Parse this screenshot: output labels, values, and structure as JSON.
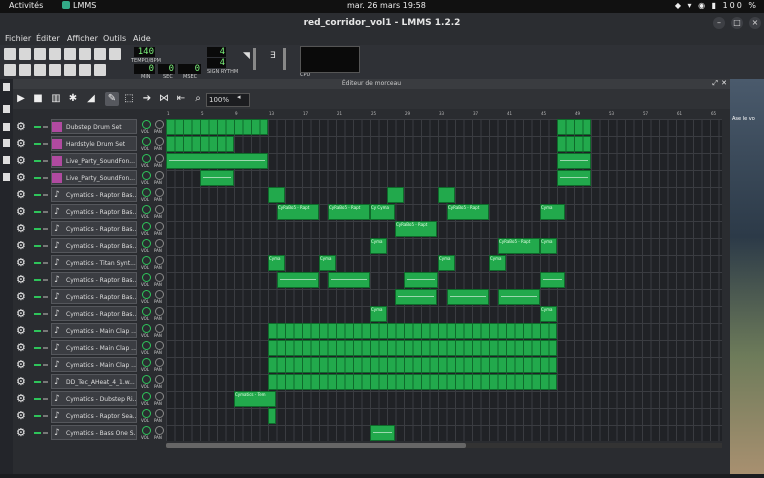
{
  "gnome": {
    "activities": "Activités",
    "app": "LMMS",
    "clock": "mar. 26 mars  19:58",
    "battery": "100 %"
  },
  "window": {
    "title": "red_corridor_vol1 - LMMS 1.2.2"
  },
  "menu": {
    "file": "Fichier",
    "edit": "Éditer",
    "view": "Afficher",
    "tools": "Outils",
    "help": "Aide"
  },
  "toolbar": {
    "tempo": "140",
    "tempo_label": "TEMPO/BPM",
    "time_min": "0",
    "time_sec": "0",
    "time_msec": "0",
    "min_label": "MIN",
    "sec_label": "SEC",
    "msec_label": "MSEC",
    "sig_num": "4",
    "sig_den": "4",
    "sig_label": "SIGN RYTHM",
    "cpu_label": "CPU"
  },
  "song_editor": {
    "title": "Éditeur de morceau",
    "zoom": "100%",
    "bars": [
      "1",
      "5",
      "9",
      "13",
      "17",
      "21",
      "25",
      "29",
      "33",
      "37",
      "41",
      "45",
      "49",
      "53",
      "57",
      "61",
      "65"
    ]
  },
  "knob_labels": {
    "vol": "VOL",
    "pan": "PAN"
  },
  "tracks": [
    {
      "name": "Dubstep Drum Set",
      "type": "drum"
    },
    {
      "name": "Hardstyle Drum Set",
      "type": "drum"
    },
    {
      "name": "Live_Party_SoundFon...",
      "type": "drum"
    },
    {
      "name": "Live_Party_SoundFon...",
      "type": "drum"
    },
    {
      "name": "Cymatics - Raptor Bas...",
      "type": "note"
    },
    {
      "name": "Cymatics - Raptor Bas...",
      "type": "note"
    },
    {
      "name": "Cymatics - Raptor Bas...",
      "type": "note"
    },
    {
      "name": "Cymatics - Raptor Bas...",
      "type": "note"
    },
    {
      "name": "Cymatics - Titan Synt...",
      "type": "note"
    },
    {
      "name": "Cymatics - Raptor Bas...",
      "type": "note"
    },
    {
      "name": "Cymatics - Raptor Bas...",
      "type": "note"
    },
    {
      "name": "Cymatics - Raptor Bas...",
      "type": "note"
    },
    {
      "name": "Cymatics - Main Clap ...",
      "type": "note"
    },
    {
      "name": "Cymatics - Main Clap ...",
      "type": "note"
    },
    {
      "name": "Cymatics - Main Clap ...",
      "type": "note"
    },
    {
      "name": "DD_Tec_AHeat_4_1.w...",
      "type": "note"
    },
    {
      "name": "Cymatics - Dubstep Ri...",
      "type": "note"
    },
    {
      "name": "Cymatics - Raptor Sea...",
      "type": "note"
    },
    {
      "name": "Cymatics - Bass One S...",
      "type": "note"
    }
  ],
  "clip_labels": {
    "a": "CyRaBo5 - Rapt",
    "b": "Cyma",
    "c": "Cy Cyma",
    "d": "Cymatics - Tem"
  },
  "desktop": {
    "note": "Ase le vo"
  }
}
